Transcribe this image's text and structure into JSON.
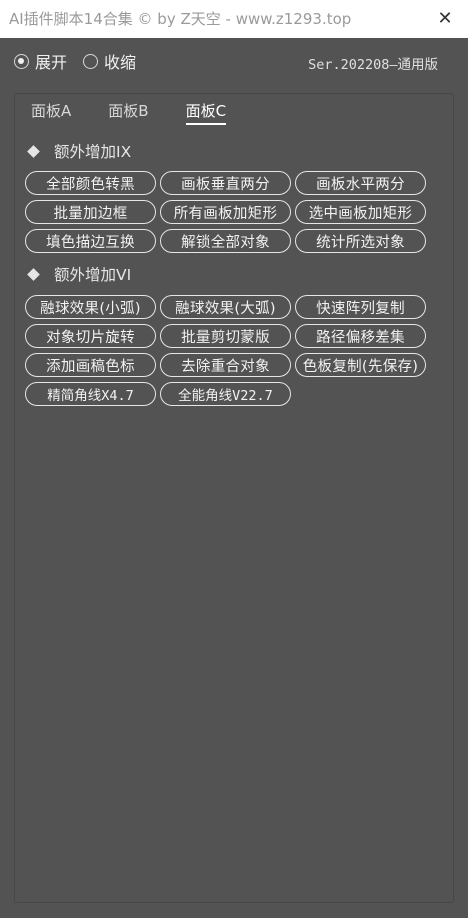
{
  "window": {
    "title": "AI插件脚本14合集 © by Z天空 - www.z1293.top",
    "close_label": "✕"
  },
  "mode": {
    "expand_label": "展开",
    "collapse_label": "收缩",
    "selected": "展开"
  },
  "version": "Ser.202208—通用版",
  "tabs": [
    {
      "label": "面板A",
      "active": false
    },
    {
      "label": "面板B",
      "active": false
    },
    {
      "label": "面板C",
      "active": true
    }
  ],
  "sections": [
    {
      "title": "额外增加IX",
      "buttons": [
        "全部颜色转黑",
        "画板垂直两分",
        "画板水平两分",
        "批量加边框",
        "所有画板加矩形",
        "选中画板加矩形",
        "填色描边互换",
        "解锁全部对象",
        "统计所选对象"
      ]
    },
    {
      "title": "额外增加VI",
      "buttons": [
        "融球效果(小弧)",
        "融球效果(大弧)",
        "快速阵列复制",
        "对象切片旋转",
        "批量剪切蒙版",
        "路径偏移差集",
        "添加画稿色标",
        "去除重合对象",
        "色板复制(先保存)",
        "精简角线X4.7",
        "全能角线V22.7"
      ]
    }
  ]
}
